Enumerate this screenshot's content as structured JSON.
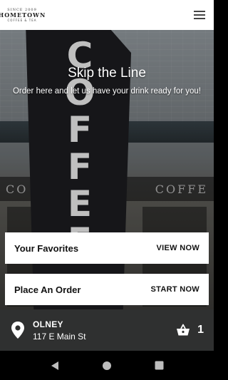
{
  "header": {
    "logo_top": "SINCE 2009",
    "logo_main": "HOMETOWN",
    "logo_sub": "COFFEE & TEA",
    "menu_icon": "hamburger-menu-icon"
  },
  "hero": {
    "title": "Skip the Line",
    "subtitle": "Order here and let us have your drink ready for you!",
    "banner_letters": [
      "C",
      "O",
      "F",
      "F",
      "E",
      "E"
    ],
    "sign_left": "CO",
    "sign_right": "COFFE"
  },
  "cards": [
    {
      "title": "Your Favorites",
      "action": "VIEW NOW"
    },
    {
      "title": "Place An Order",
      "action": "START NOW"
    }
  ],
  "location": {
    "city": "OLNEY",
    "address": "117 E Main St",
    "pin_icon": "location-pin-icon",
    "basket_icon": "basket-icon",
    "basket_count": "1"
  },
  "colors": {
    "topbar": "#ffffff",
    "location_bar": "#2f3030",
    "card": "#ffffff",
    "navbar": "#000000"
  }
}
